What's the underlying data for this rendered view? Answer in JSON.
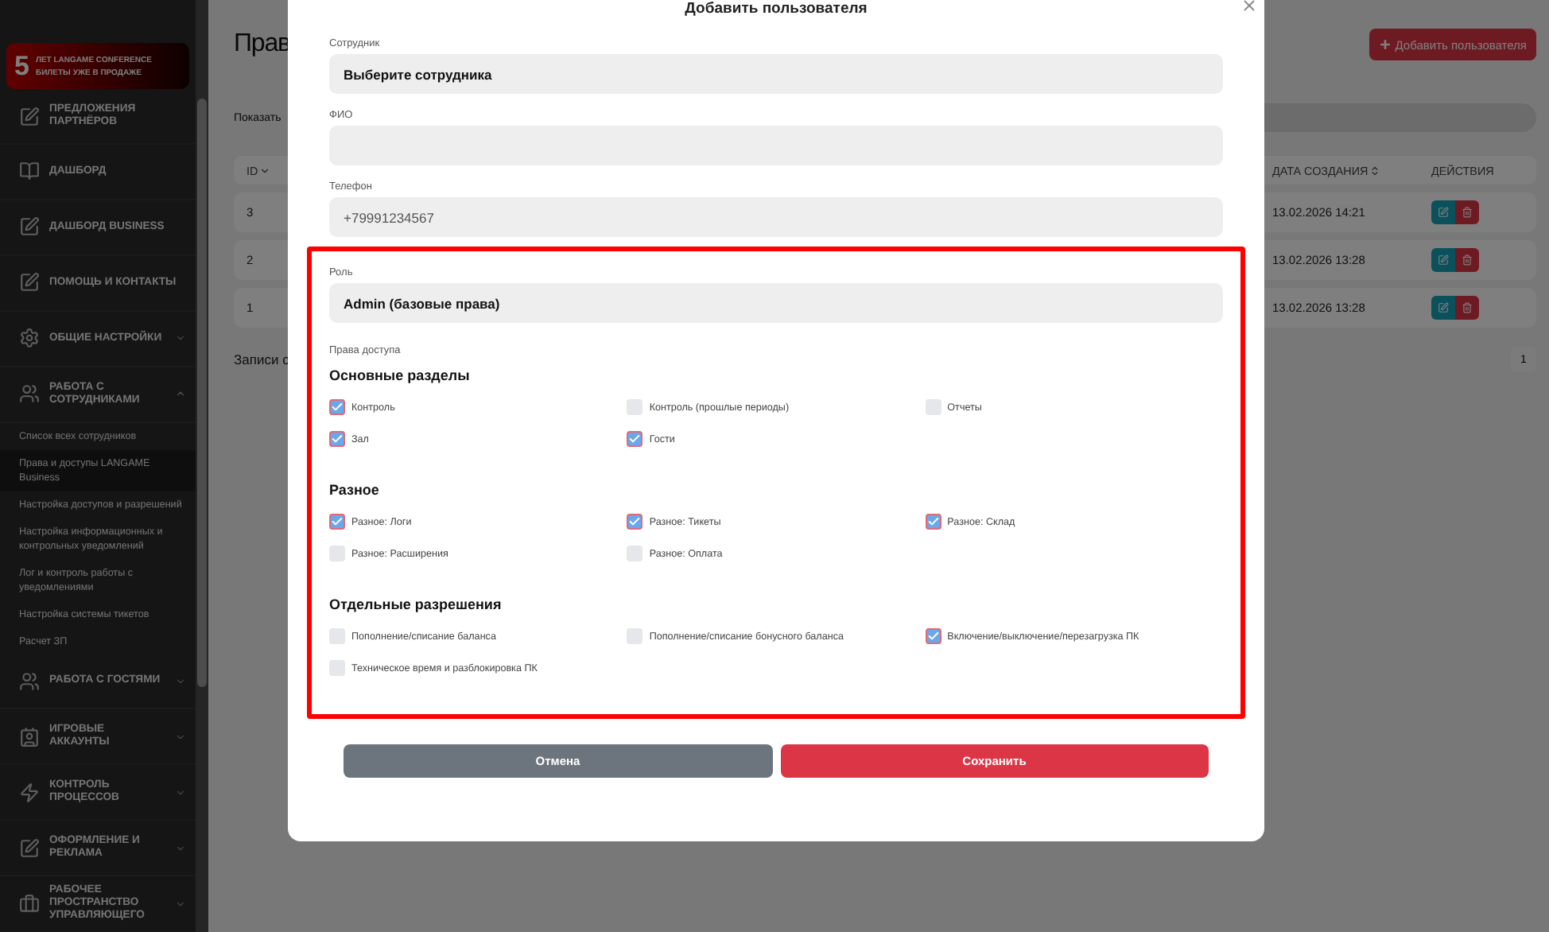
{
  "sidebar": {
    "promo": {
      "number": "5",
      "line_1": "ЛЕТ LANGAME CONFERENCE",
      "line_2": "БИЛЕТЫ УЖЕ В ПРОДАЖЕ"
    },
    "items": [
      {
        "kind": "link",
        "label": "ПРЕДЛОЖЕНИЯ ПАРТНЁРОВ"
      },
      {
        "kind": "link",
        "label": "ДАШБОРД"
      },
      {
        "kind": "link",
        "label": "ДАШБОРД BUSINESS"
      },
      {
        "kind": "link",
        "label": "ПОМОЩЬ И КОНТАКТЫ"
      },
      {
        "kind": "group",
        "label": "ОБЩИЕ НАСТРОЙКИ",
        "expanded": false
      },
      {
        "kind": "group",
        "label": "РАБОТА С СОТРУДНИКАМИ",
        "expanded": true,
        "children": [
          {
            "label": "Список всех сотрудников",
            "selected": false
          },
          {
            "label": "Права и доступы LANGAME Business",
            "selected": true
          },
          {
            "label": "Настройка доступов и разрешений",
            "selected": false
          },
          {
            "label": "Настройка информационных и контрольных уведомлений",
            "selected": false
          },
          {
            "label": "Лог и контроль работы с уведомлениями",
            "selected": false
          },
          {
            "label": "Настройка системы тикетов",
            "selected": false
          },
          {
            "label": "Расчет ЗП",
            "selected": false
          }
        ]
      },
      {
        "kind": "group",
        "label": "РАБОТА С ГОСТЯМИ",
        "expanded": false
      },
      {
        "kind": "group",
        "label": "ИГРОВЫЕ АККАУНТЫ",
        "expanded": false
      },
      {
        "kind": "group",
        "label": "КОНТРОЛЬ ПРОЦЕССОВ",
        "expanded": false
      },
      {
        "kind": "group",
        "label": "ОФОРМЛЕНИЕ И РЕКЛАМА",
        "expanded": false
      },
      {
        "kind": "group",
        "label": "РАБОЧЕЕ ПРОСТРАНСТВО УПРАВЛЯЮЩЕГО",
        "expanded": false
      }
    ]
  },
  "page": {
    "title": "Прав",
    "add_button": "Добавить пользователя",
    "show_label": "Показать",
    "table": {
      "columns": [
        {
          "label": "ID"
        },
        {
          "label": "ДАТА СОЗДАНИЯ"
        },
        {
          "label": "ДЕЙСТВИЯ"
        }
      ],
      "rows": [
        {
          "id": "3",
          "created": "13.02.2026 14:21"
        },
        {
          "id": "2",
          "created": "13.02.2026 13:28"
        },
        {
          "id": "1",
          "created": "13.02.2026 13:28"
        }
      ]
    },
    "footer": "Записи с",
    "pages": [
      "1"
    ]
  },
  "modal": {
    "title": "Добавить пользователя",
    "fields": [
      {
        "kind": "select",
        "label": "Сотрудник",
        "value": "Выберите сотрудника"
      },
      {
        "kind": "input",
        "label": "ФИО"
      },
      {
        "kind": "input",
        "label": "Телефон",
        "placeholder": "+79991234567"
      }
    ],
    "role": {
      "label": "Роль",
      "value": "Admin (базовые права)"
    },
    "permissions_label": "Права доступа",
    "sections": [
      {
        "title": "Основные разделы",
        "items": [
          {
            "label": "Контроль",
            "checked": true
          },
          {
            "label": "Контроль (прошлые периоды)",
            "checked": false
          },
          {
            "label": "Отчеты",
            "checked": false
          },
          {
            "label": "Зал",
            "checked": true
          },
          {
            "label": "Гости",
            "checked": true
          }
        ]
      },
      {
        "title": "Разное",
        "items": [
          {
            "label": "Разное: Логи",
            "checked": true
          },
          {
            "label": "Разное: Тикеты",
            "checked": true
          },
          {
            "label": "Разное: Склад",
            "checked": true
          },
          {
            "label": "Разное: Расширения",
            "checked": false
          },
          {
            "label": "Разное: Оплата",
            "checked": false
          }
        ]
      },
      {
        "title": "Отдельные разрешения",
        "items": [
          {
            "label": "Пополнение/списание баланса",
            "checked": false
          },
          {
            "label": "Пополнение/списание бонусного баланса",
            "checked": false
          },
          {
            "label": "Включение/выключение/перезагрузка ПК",
            "checked": true
          },
          {
            "label": "Техническое время и разблокировка ПК",
            "checked": false
          }
        ]
      }
    ],
    "buttons": [
      {
        "kind": "cancel",
        "label": "Отмена"
      },
      {
        "kind": "save",
        "label": "Сохранить"
      }
    ]
  }
}
